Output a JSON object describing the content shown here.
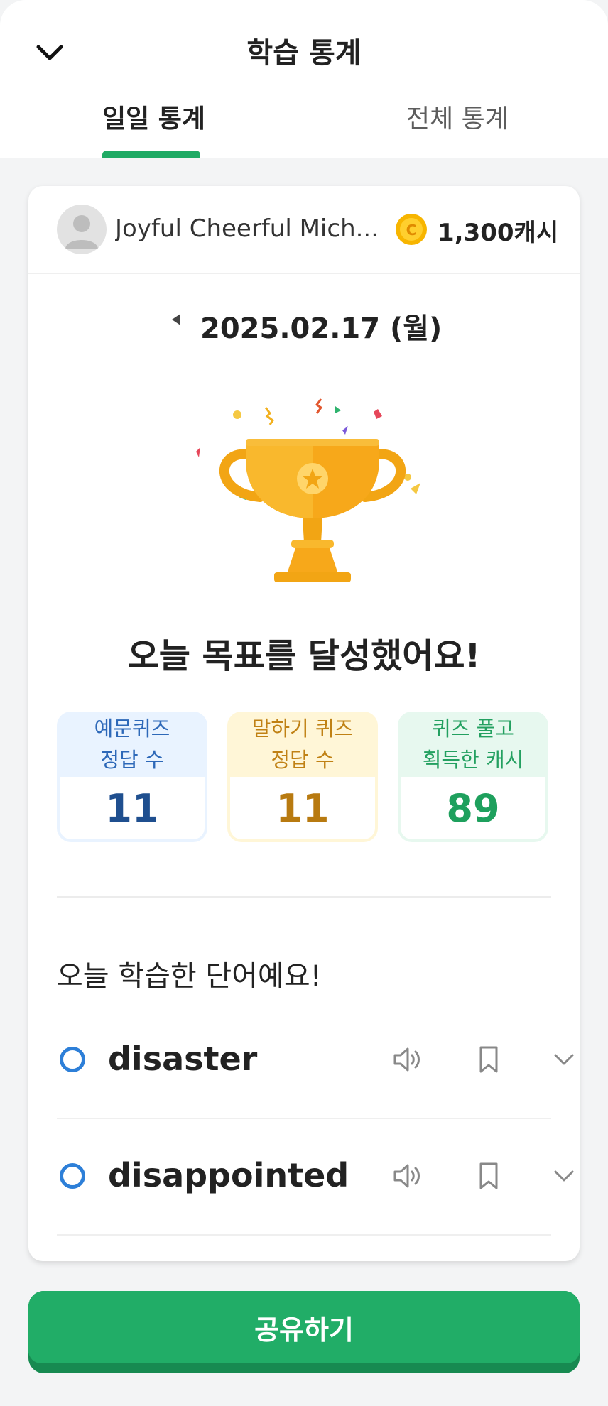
{
  "header": {
    "title": "학습 통계",
    "collapse_icon": "chevron-down-icon",
    "tabs": [
      {
        "label": "일일 통계",
        "active": true
      },
      {
        "label": "전체 통계",
        "active": false
      }
    ]
  },
  "profile": {
    "name": "Joyful Cheerful Mich...",
    "cash": "1,300캐시",
    "coin_icon": "coin-icon"
  },
  "date": {
    "label": "2025.02.17 (월)"
  },
  "achievement": {
    "headline": "오늘 목표를 달성했어요!"
  },
  "stats": [
    {
      "line1": "예문퀴즈",
      "line2": "정답 수",
      "value": "11",
      "color": "#1f4f8f"
    },
    {
      "line1": "말하기 퀴즈",
      "line2": "정답 수",
      "value": "11",
      "color": "#b87a10"
    },
    {
      "line1": "퀴즈 풀고",
      "line2": "획득한 캐시",
      "value": "89",
      "color": "#1ea05d"
    }
  ],
  "words": {
    "heading": "오늘 학습한 단어예요!",
    "items": [
      {
        "word": "disaster"
      },
      {
        "word": "disappointed"
      }
    ]
  },
  "share_button": {
    "label": "공유하기"
  },
  "colors": {
    "accent": "#1eaa64",
    "word_status": "#2d7fd8"
  }
}
